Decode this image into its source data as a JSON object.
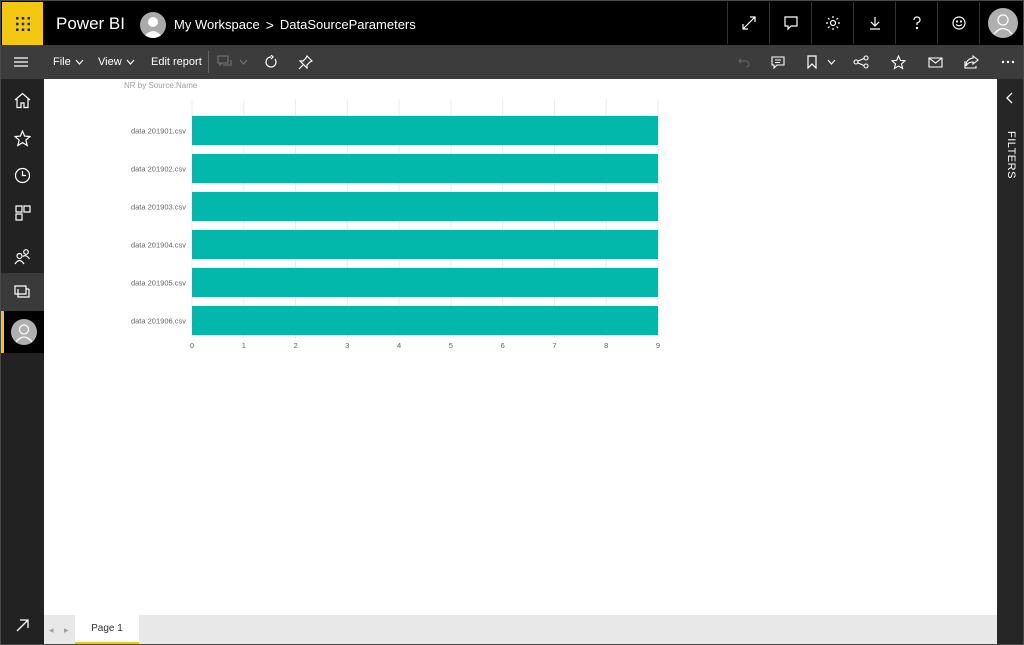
{
  "header": {
    "brand": "Power BI",
    "breadcrumb": {
      "workspace": "My Workspace",
      "separator": ">",
      "report": "DataSourceParameters"
    },
    "icons": [
      "app-launcher-icon",
      "fullscreen-icon",
      "comment-icon",
      "settings-icon",
      "download-icon",
      "help-icon",
      "feedback-smiley-icon",
      "user-avatar"
    ]
  },
  "toolbar": {
    "file_label": "File",
    "view_label": "View",
    "edit_label": "Edit report",
    "icons": [
      "hamburger-icon",
      "chat-icon",
      "refresh-icon",
      "pin-icon",
      "undo-icon",
      "comment-icon",
      "bookmark-icon",
      "share-graph-icon",
      "favorite-star-icon",
      "email-icon",
      "export-icon",
      "more-icon"
    ]
  },
  "leftnav": {
    "icons": [
      "home-icon",
      "favorites-star-icon",
      "recent-clock-icon",
      "apps-icon",
      "shared-people-icon",
      "workspaces-icon",
      "user-avatar",
      "expand-arrow-icon"
    ]
  },
  "filters": {
    "label": "FILTERS"
  },
  "pages": {
    "tab": "Page 1"
  },
  "colors": {
    "bar": "#01b8aa",
    "header": "#000000",
    "toolbar": "#3c3c3c",
    "accent": "#f2c811"
  },
  "chart_data": {
    "type": "bar",
    "orientation": "horizontal",
    "title": "NR by Source.Name",
    "categories": [
      "data 201901.csv",
      "data 201902.csv",
      "data 201903.csv",
      "data 201904.csv",
      "data 201905.csv",
      "data 201906.csv"
    ],
    "values": [
      9,
      9,
      9,
      9,
      9,
      9
    ],
    "xlim": [
      0,
      9
    ],
    "xticks": [
      "0",
      "1",
      "2",
      "3",
      "4",
      "5",
      "6",
      "7",
      "8",
      "9"
    ],
    "grid": true
  }
}
